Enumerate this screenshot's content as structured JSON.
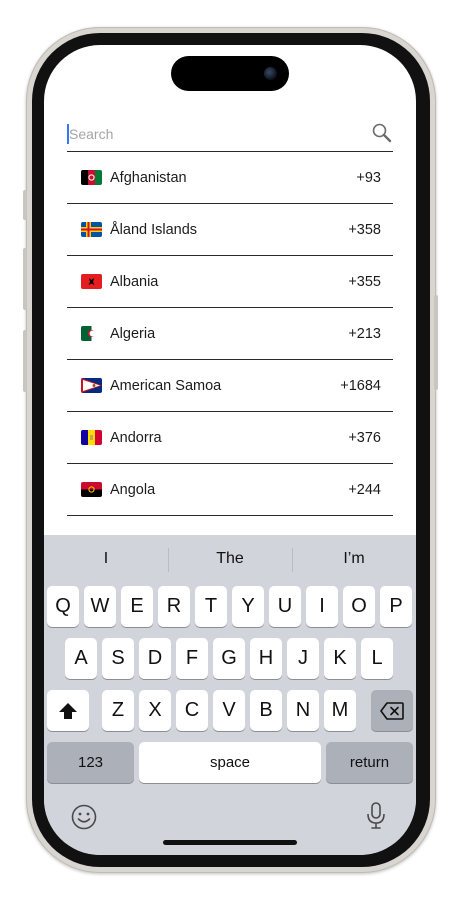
{
  "search": {
    "placeholder": "Search"
  },
  "countries": [
    {
      "name": "Afghanistan",
      "code": "+93",
      "flag": "afghanistan-flag"
    },
    {
      "name": "Åland Islands",
      "code": "+358",
      "flag": "aland-flag"
    },
    {
      "name": "Albania",
      "code": "+355",
      "flag": "albania-flag"
    },
    {
      "name": "Algeria",
      "code": "+213",
      "flag": "algeria-flag"
    },
    {
      "name": "American Samoa",
      "code": "+1684",
      "flag": "american-samoa-flag"
    },
    {
      "name": "Andorra",
      "code": "+376",
      "flag": "andorra-flag"
    },
    {
      "name": "Angola",
      "code": "+244",
      "flag": "angola-flag"
    }
  ],
  "keyboard": {
    "suggestions": [
      "I",
      "The",
      "I’m"
    ],
    "row1": [
      "Q",
      "W",
      "E",
      "R",
      "T",
      "Y",
      "U",
      "I",
      "O",
      "P"
    ],
    "row2": [
      "A",
      "S",
      "D",
      "F",
      "G",
      "H",
      "J",
      "K",
      "L"
    ],
    "row3": [
      "Z",
      "X",
      "C",
      "V",
      "B",
      "N",
      "M"
    ],
    "numbers_label": "123",
    "space_label": "space",
    "return_label": "return"
  },
  "colors": {
    "caret": "#3478f6",
    "keyboard_bg": "#d1d4da"
  }
}
